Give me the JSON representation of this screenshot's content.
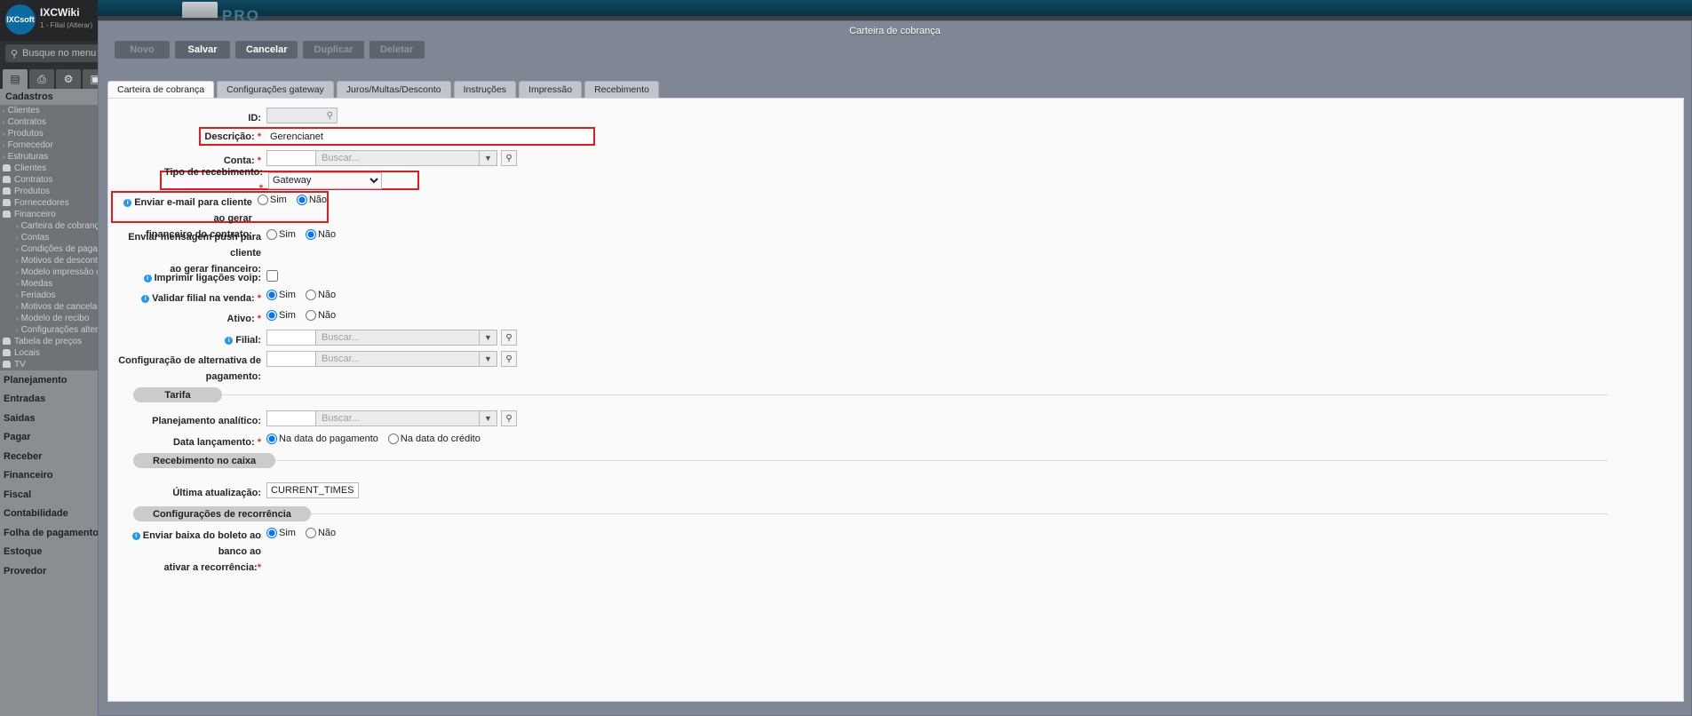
{
  "app": {
    "brand_name": "IXCWiki",
    "brand_logo_text": "IXCsoft",
    "branch_label": "1 - Filial (Alterar)",
    "logout_icon": "logout-icon",
    "pro_badge": "PRO",
    "search": {
      "placeholder": "Busque no menu",
      "icon": "search-icon"
    },
    "toolbar_icons": [
      {
        "name": "list-icon",
        "glyph": "▤"
      },
      {
        "name": "printer-icon",
        "glyph": "⎙"
      },
      {
        "name": "gears-icon",
        "glyph": "⚙"
      },
      {
        "name": "extra-icon",
        "glyph": "▣"
      }
    ]
  },
  "sidebar": {
    "section_title": "Cadastros",
    "tree": [
      {
        "label": "Clientes",
        "type": "arrow",
        "level": 1
      },
      {
        "label": "Contratos",
        "type": "arrow",
        "level": 1
      },
      {
        "label": "Produtos",
        "type": "arrow",
        "level": 1
      },
      {
        "label": "Fornecedor",
        "type": "arrow",
        "level": 1
      },
      {
        "label": "Estruturas",
        "type": "arrow",
        "level": 1
      },
      {
        "label": "Clientes",
        "type": "folder",
        "level": 1
      },
      {
        "label": "Contratos",
        "type": "folder",
        "level": 1
      },
      {
        "label": "Produtos",
        "type": "folder",
        "level": 1
      },
      {
        "label": "Fornecedores",
        "type": "folder",
        "level": 1
      },
      {
        "label": "Financeiro",
        "type": "folder",
        "level": 1
      },
      {
        "label": "Carteira de cobrança",
        "type": "arrow",
        "level": 2
      },
      {
        "label": "Contas",
        "type": "arrow",
        "level": 2
      },
      {
        "label": "Condições de pagamento",
        "type": "arrow",
        "level": 2
      },
      {
        "label": "Motivos de desconto",
        "type": "arrow",
        "level": 2
      },
      {
        "label": "Modelo impressão de R",
        "type": "arrow",
        "level": 2
      },
      {
        "label": "Moedas",
        "type": "arrow",
        "level": 2
      },
      {
        "label": "Feriados",
        "type": "arrow",
        "level": 2
      },
      {
        "label": "Motivos de cancelamento",
        "type": "arrow",
        "level": 2
      },
      {
        "label": "Modelo de recibo",
        "type": "arrow",
        "level": 2
      },
      {
        "label": "Configurações alternativ",
        "type": "arrow",
        "level": 2
      },
      {
        "label": "Tabela de preços",
        "type": "folder",
        "level": 1
      },
      {
        "label": "Locais",
        "type": "folder",
        "level": 1
      },
      {
        "label": "TV",
        "type": "folder",
        "level": 1
      }
    ],
    "main_items": [
      "Planejamento",
      "Entradas",
      "Saidas",
      "Pagar",
      "Receber",
      "Financeiro",
      "Fiscal",
      "Contabilidade",
      "Folha de pagamento",
      "Estoque",
      "Provedor"
    ]
  },
  "modal": {
    "title": "Carteira de cobrança",
    "toolbar": [
      {
        "label": "Novo",
        "enabled": false
      },
      {
        "label": "Salvar",
        "enabled": true
      },
      {
        "label": "Cancelar",
        "enabled": true
      },
      {
        "label": "Duplicar",
        "enabled": false
      },
      {
        "label": "Deletar",
        "enabled": false
      }
    ],
    "tabs": [
      {
        "label": "Carteira de cobrança",
        "active": true
      },
      {
        "label": "Configurações gateway",
        "active": false
      },
      {
        "label": "Juros/Multas/Desconto",
        "active": false
      },
      {
        "label": "Instruções",
        "active": false
      },
      {
        "label": "Impressão",
        "active": false
      },
      {
        "label": "Recebimento",
        "active": false
      }
    ]
  },
  "form": {
    "id": {
      "label": "ID:",
      "value": "",
      "icon": "search-icon"
    },
    "descricao": {
      "label": "Descrição:",
      "required": true,
      "value": "Gerencianet",
      "highlighted": true
    },
    "conta": {
      "label": "Conta:",
      "required": true,
      "key": "",
      "placeholder": "Buscar...",
      "caret": "chevron-down-icon",
      "magnifier": "magnifier-icon"
    },
    "tipo_recebimento": {
      "label": "Tipo de recebimento:",
      "required": true,
      "value": "Gateway",
      "options": [
        "Gateway"
      ],
      "highlighted": true
    },
    "enviar_email": {
      "label_line1": "Enviar e-mail para cliente ao gerar",
      "label_line2": "financeiro do contrato:",
      "info": true,
      "highlighted": true,
      "options": [
        "Sim",
        "Não"
      ],
      "selected": "Não"
    },
    "enviar_push": {
      "label_line1": "Enviar mensagem push para cliente",
      "label_line2": "ao gerar financeiro:",
      "options": [
        "Sim",
        "Não"
      ],
      "selected": "Não"
    },
    "imprimir_voip": {
      "label": "Imprimir ligações voip:",
      "info": true,
      "checked": false
    },
    "validar_filial": {
      "label": "Validar filial na venda:",
      "required": true,
      "info": true,
      "options": [
        "Sim",
        "Não"
      ],
      "selected": "Sim"
    },
    "ativo": {
      "label": "Ativo:",
      "required": true,
      "options": [
        "Sim",
        "Não"
      ],
      "selected": "Sim"
    },
    "filial": {
      "label": "Filial:",
      "info": true,
      "key": "",
      "placeholder": "Buscar..."
    },
    "config_alternativa": {
      "label_line1": "Configuração de alternativa de",
      "label_line2": "pagamento:",
      "key": "",
      "placeholder": "Buscar..."
    },
    "legend_tarifa": "Tarifa",
    "planejamento_analitico": {
      "label": "Planejamento analítico:",
      "key": "",
      "placeholder": "Buscar..."
    },
    "data_lancamento": {
      "label": "Data lançamento:",
      "required": true,
      "options": [
        "Na data do pagamento",
        "Na data do crédito"
      ],
      "selected": "Na data do pagamento"
    },
    "legend_recebimento_caixa": "Recebimento no caixa",
    "ultima_atualizacao": {
      "label": "Última atualização:",
      "value": "CURRENT_TIMESTAMP"
    },
    "legend_recorrencia": "Configurações de recorrência",
    "enviar_baixa": {
      "label_line1": "Enviar baixa do boleto ao banco ao",
      "label_line2": "ativar a recorrência:",
      "required": true,
      "info": true,
      "options": [
        "Sim",
        "Não"
      ],
      "selected": "Sim"
    }
  },
  "colors": {
    "modal_chrome": "#7e8793",
    "highlight_red": "#e8191d",
    "required_red": "#d32f2f",
    "info_blue": "#2196f3",
    "topbar_blue": "#0e4861"
  }
}
